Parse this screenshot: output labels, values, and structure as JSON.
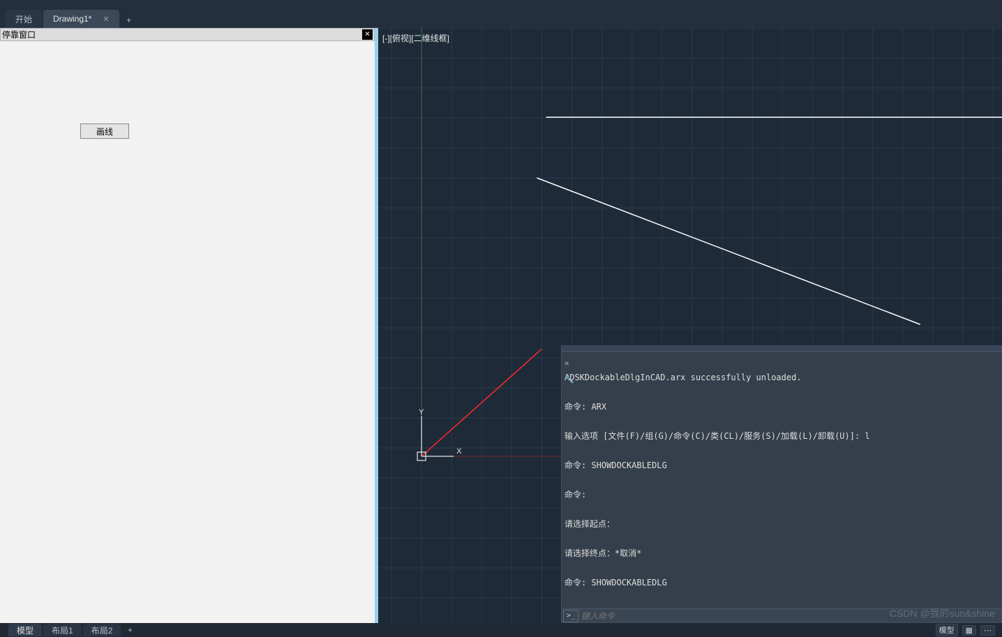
{
  "tabs": {
    "start": "开始",
    "drawing": "Drawing1*",
    "add_tooltip": "+"
  },
  "dock": {
    "title": "停靠窗口",
    "draw_button": "画线"
  },
  "viewport": {
    "label": "[-][俯视][二维线框]",
    "axis_y": "Y",
    "axis_x": "X"
  },
  "command": {
    "lines": [
      "ADSKDockableDlgInCAD.arx successfully unloaded.",
      "命令: ARX",
      "输入选项 [文件(F)/组(G)/命令(C)/类(CL)/服务(S)/加载(L)/卸载(U)]: l",
      "命令: SHOWDOCKABLEDLG",
      "命令:",
      "请选择起点：",
      "请选择终点：*取消*",
      "命令: SHOWDOCKABLEDLG"
    ],
    "placeholder": "键入命令"
  },
  "bottom_tabs": {
    "model": "模型",
    "layout1": "布局1",
    "layout2": "布局2"
  },
  "status": {
    "model": "模型"
  },
  "watermark": "CSDN @我的sun&shine"
}
